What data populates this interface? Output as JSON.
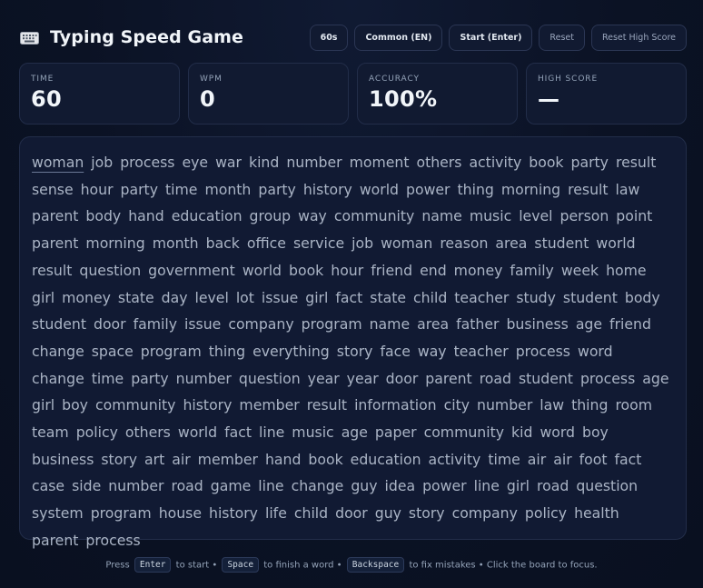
{
  "header": {
    "title": "Typing Speed Game",
    "icon": "keyboard-icon"
  },
  "controls": {
    "duration": "60s",
    "word_set": "Common (EN)",
    "start": "Start (Enter)",
    "reset": "Reset",
    "reset_high_score": "Reset High Score"
  },
  "stats": {
    "time": {
      "label": "Time",
      "value": "60"
    },
    "wpm": {
      "label": "WPM",
      "value": "0"
    },
    "accuracy": {
      "label": "Accuracy",
      "value": "100%"
    },
    "high_score": {
      "label": "High Score",
      "value": "—"
    }
  },
  "board": {
    "current_index": 0,
    "words": [
      "woman",
      "job",
      "process",
      "eye",
      "war",
      "kind",
      "number",
      "moment",
      "others",
      "activity",
      "book",
      "party",
      "result",
      "sense",
      "hour",
      "party",
      "time",
      "month",
      "party",
      "history",
      "world",
      "power",
      "thing",
      "morning",
      "result",
      "law",
      "parent",
      "body",
      "hand",
      "education",
      "group",
      "way",
      "community",
      "name",
      "music",
      "level",
      "person",
      "point",
      "parent",
      "morning",
      "month",
      "back",
      "office",
      "service",
      "job",
      "woman",
      "reason",
      "area",
      "student",
      "world",
      "result",
      "question",
      "government",
      "world",
      "book",
      "hour",
      "friend",
      "end",
      "money",
      "family",
      "week",
      "home",
      "girl",
      "money",
      "state",
      "day",
      "level",
      "lot",
      "issue",
      "girl",
      "fact",
      "state",
      "child",
      "teacher",
      "study",
      "student",
      "body",
      "student",
      "door",
      "family",
      "issue",
      "company",
      "program",
      "name",
      "area",
      "father",
      "business",
      "age",
      "friend",
      "change",
      "space",
      "program",
      "thing",
      "everything",
      "story",
      "face",
      "way",
      "teacher",
      "process",
      "word",
      "change",
      "time",
      "party",
      "number",
      "question",
      "year",
      "year",
      "door",
      "parent",
      "road",
      "student",
      "process",
      "age",
      "girl",
      "boy",
      "community",
      "history",
      "member",
      "result",
      "information",
      "city",
      "number",
      "law",
      "thing",
      "room",
      "team",
      "policy",
      "others",
      "world",
      "fact",
      "line",
      "music",
      "age",
      "paper",
      "community",
      "kid",
      "word",
      "boy",
      "business",
      "story",
      "art",
      "air",
      "member",
      "hand",
      "book",
      "education",
      "activity",
      "time",
      "air",
      "air",
      "foot",
      "fact",
      "case",
      "side",
      "number",
      "road",
      "game",
      "line",
      "change",
      "guy",
      "idea",
      "power",
      "line",
      "girl",
      "road",
      "question",
      "system",
      "program",
      "house",
      "history",
      "life",
      "child",
      "door",
      "guy",
      "story",
      "company",
      "policy",
      "health",
      "parent",
      "process"
    ]
  },
  "hint": {
    "press": "Press",
    "enter_key": "Enter",
    "to_start": "to start •",
    "space_key": "Space",
    "finish_word": "to finish a word •",
    "backspace_key": "Backspace",
    "fix_mistakes": "to fix mistakes • Click the board to focus."
  }
}
